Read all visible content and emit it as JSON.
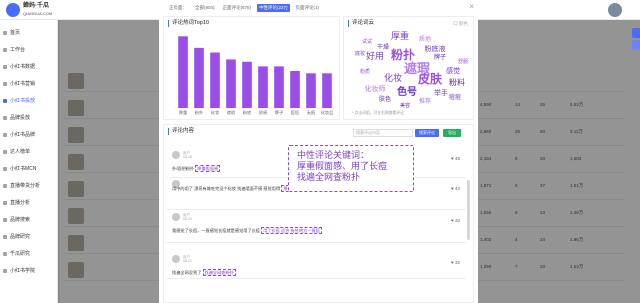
{
  "brand": {
    "name_line1": "蝉妈·千瓜",
    "name_line2": "QIANGUA.COM"
  },
  "sidebar": {
    "items": [
      {
        "label": "首页"
      },
      {
        "label": "工作台"
      },
      {
        "label": "小红书数据"
      },
      {
        "label": "小红书营销"
      },
      {
        "label": "小红书投放"
      },
      {
        "label": "品牌投放"
      },
      {
        "label": "小红书品牌"
      },
      {
        "label": "达人榜单"
      },
      {
        "label": "小红书MCN"
      },
      {
        "label": "直播带货分析"
      },
      {
        "label": "直播分析"
      },
      {
        "label": "品牌搜索"
      },
      {
        "label": "品牌研究"
      },
      {
        "label": "千瓜研究"
      },
      {
        "label": "小红书学院"
      }
    ]
  },
  "modal": {
    "tabs": [
      {
        "label": "正负面："
      },
      {
        "label": "全部(904)"
      },
      {
        "label": "正面评论(676)"
      },
      {
        "label": "中性评论(227)"
      },
      {
        "label": "负面评论(1)"
      }
    ],
    "active_tab": 3,
    "close": "×",
    "hot_words": {
      "title": "评论热词Top10",
      "chart_data": {
        "type": "bar",
        "categories": [
          "厚重",
          "粉扑",
          "化妆",
          "遮瑕",
          "粉底",
          "质感",
          "牌子",
          "痘痘",
          "无痕",
          "化妆品"
        ],
        "values": [
          31,
          26,
          24,
          21,
          20,
          18,
          18,
          16,
          15,
          15
        ],
        "ylim": [
          0,
          32
        ],
        "color": "#9b4dea"
      }
    },
    "word_cloud": {
      "title": "评论词云",
      "subtitle": "口 颜色",
      "words": [
        "厚重",
        "试试",
        "干燥",
        "质地",
        "粉底液",
        "好用",
        "粉扑",
        "牌子",
        "遮瑕",
        "感觉",
        "化妆",
        "皮肤",
        "粉料",
        "化妆师",
        "色号",
        "举手",
        "粉质",
        "肤色",
        "推荐",
        "痘痘",
        "底妆",
        "舒服",
        "美容"
      ],
      "note": "* 点击词组，可在右侧查看评论"
    },
    "comments_panel": {
      "title": "评论内容",
      "search_placeholder": "搜索评论内容",
      "search_button": "搜索评论",
      "export_button": "导出"
    },
    "callout": {
      "line1": "中性评论关键词：",
      "line2": "厚重假面感、用了长痘",
      "line3": "找遍全网查粉扑"
    },
    "comments": [
      {
        "user": "用户",
        "date": "08-18",
        "text": "扑/面把粉扑",
        "tag": "厚重假面感",
        "likes": "46"
      },
      {
        "user": "",
        "date": "",
        "text": "用中的用了 漂亮有做吃完没个化妆 找遍墙面不感 感觉用得",
        "tag": "厚重",
        "likes": "44"
      },
      {
        "user": "用户",
        "date": "08-20",
        "text": "我感觉了长痘，一直感觉长痘就是感觉用了长痘",
        "tag": "用了长痘 适合 有些地方一直痘",
        "likes": "33"
      },
      {
        "user": "用户",
        "date": "08-21",
        "text": "找遍全网没到了",
        "tag": "找遍全网查粉扑",
        "likes": "32"
      }
    ]
  },
  "background": {
    "right_values": [
      [
        "4,594",
        "14",
        "26",
        "5.53万"
      ],
      [
        "2,660",
        "26",
        "50",
        "3.11万"
      ],
      [
        "2,184",
        "9",
        "20",
        "1,683"
      ],
      [
        "1,871",
        "8",
        "37",
        "1.51万"
      ],
      [
        "1,556",
        "8",
        "23",
        "1.08万"
      ],
      [
        "1,402",
        "4",
        "24",
        "1.95万"
      ],
      [
        "1,290",
        "7",
        "20",
        "1.53万"
      ]
    ]
  }
}
